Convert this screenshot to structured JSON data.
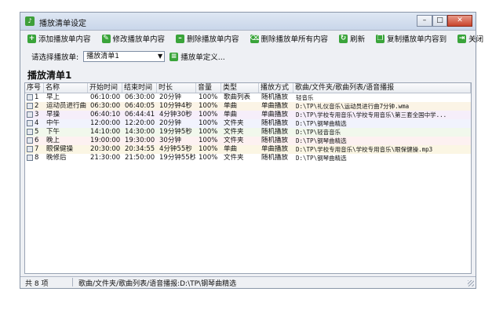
{
  "window": {
    "title": "播放清单设定",
    "controls": {
      "minimize": "–",
      "maximize": "□",
      "close": "✕"
    }
  },
  "toolbar": {
    "items": [
      {
        "label": "添加播放单内容",
        "icon": "plus-icon",
        "color": "#3aa43a",
        "glyph": "+"
      },
      {
        "label": "修改播放单内容",
        "icon": "edit-icon",
        "color": "#3aa43a",
        "glyph": "✎"
      },
      {
        "label": "删除播放单内容",
        "icon": "minus-icon",
        "color": "#3aa43a",
        "glyph": "–"
      },
      {
        "label": "删除播放单所有内容",
        "icon": "trash-icon",
        "color": "#3aa43a",
        "glyph": "⌫"
      },
      {
        "label": "刷新",
        "icon": "refresh-icon",
        "color": "#3aa43a",
        "glyph": "↻"
      },
      {
        "label": "复制播放单内容到",
        "icon": "copy-icon",
        "color": "#3aa43a",
        "glyph": "❐"
      },
      {
        "label": "关闭",
        "icon": "exit-icon",
        "color": "#3aa43a",
        "glyph": "⇥"
      }
    ]
  },
  "selector": {
    "label": "请选择播放单:",
    "value": "播放清单1",
    "define_label": "播放单定义..."
  },
  "heading": "播放清单1",
  "table": {
    "headers": [
      "序号",
      "名称",
      "开始时间",
      "结束时间",
      "时长",
      "音量",
      "类型",
      "播放方式",
      "歌曲/文件夹/歌曲列表/语音播报"
    ],
    "rows": [
      [
        "1",
        "早上",
        "06:10:00",
        "06:30:00",
        "20分钟",
        "100%",
        "歌曲列表",
        "随机播放",
        "轻音乐"
      ],
      [
        "2",
        "运动员进行曲",
        "06:30:00",
        "06:40:05",
        "10分钟4秒",
        "100%",
        "单曲",
        "单曲播放",
        "D:\\TP\\礼仪音乐\\运动员进行曲7分钟.wma"
      ],
      [
        "3",
        "早操",
        "06:40:10",
        "06:44:41",
        "4分钟30秒",
        "100%",
        "单曲",
        "单曲播放",
        "D:\\TP\\学校专用音乐\\学校专用音乐\\第三套全国中学..."
      ],
      [
        "4",
        "中午",
        "12:00:00",
        "12:20:00",
        "20分钟",
        "100%",
        "文件夹",
        "随机播放",
        "D:\\TP\\钢琴曲精选"
      ],
      [
        "5",
        "下午",
        "14:10:00",
        "14:30:00",
        "19分钟5秒",
        "100%",
        "文件夹",
        "随机播放",
        "D:\\TP\\轻音音乐"
      ],
      [
        "6",
        "晚上",
        "19:00:00",
        "19:30:00",
        "30分钟",
        "100%",
        "文件夹",
        "随机播放",
        "D:\\TP\\钢琴曲精选"
      ],
      [
        "7",
        "眼保健操",
        "20:30:00",
        "20:34:55",
        "4分钟55秒",
        "100%",
        "单曲",
        "单曲播放",
        "D:\\TP\\学校专用音乐\\学校专用音乐\\眼保健操.mp3"
      ],
      [
        "8",
        "晚修后",
        "21:30:00",
        "21:50:00",
        "19分钟55秒",
        "100%",
        "文件夹",
        "随机播放",
        "D:\\TP\\钢琴曲精选"
      ]
    ],
    "row_colors": [
      "#ffffff",
      "#fbf4e6",
      "#f6eefa",
      "#f1f3fd",
      "#f1f8ec",
      "#fdf1f1",
      "#fbf6e4",
      "#ffffff"
    ]
  },
  "status": {
    "count": "共 8 项",
    "detail": "歌曲/文件夹/歌曲列表/语音播报:D:\\TP\\钢琴曲精选"
  }
}
